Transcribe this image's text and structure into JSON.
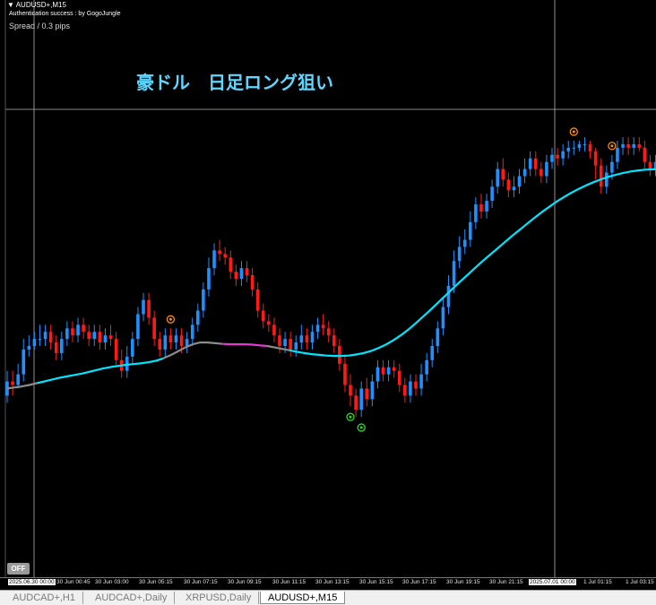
{
  "window": {
    "symbol_line": "▼ AUDUSD+,M15",
    "auth_line": "Authentication success : by GogoJungle",
    "spread_line": "Spread / 0.3 pips"
  },
  "headline": "豪ドル　日足ロング狙い",
  "off_button": "OFF",
  "colors": {
    "background": "#000000",
    "bull_candle": "#1e90ff",
    "bear_candle": "#ff1a1a",
    "ma_rising": "#00e5ff",
    "ma_falling": "#e23ad0",
    "ma_flat": "#8c8c8c",
    "signal_sell": "#ff8c00",
    "signal_buy": "#22dd22",
    "crosshair": "#b4b4b4",
    "headline": "#5fd7ff"
  },
  "time_axis": {
    "labels": [
      "2025.06.30 00:00",
      "30 Jun 00:45",
      "30 Jun 03:00",
      "30 Jun 05:15",
      "30 Jun 07:15",
      "30 Jun 09:15",
      "30 Jun 11:15",
      "30 Jun 13:15",
      "30 Jun 15:15",
      "30 Jun 17:15",
      "30 Jun 19:15",
      "30 Jun 21:15",
      "2025.07.01 00:00",
      "1 Jul 01:15",
      "1 Jul 03:15"
    ],
    "highlighted": [
      "2025.06.30 00:00",
      "2025.07.01 00:00"
    ]
  },
  "tabs": [
    {
      "label": "AUDCAD+,H1",
      "active": false
    },
    {
      "label": "AUDCAD+,Daily",
      "active": false
    },
    {
      "label": "XRPUSD,Daily",
      "active": false
    },
    {
      "label": "AUDUSD+,M15",
      "active": true
    }
  ],
  "chart_data": {
    "type": "candlestick",
    "symbol": "AUDUSD+",
    "timeframe": "M15",
    "description": "Relative price level 0-100 (price axis not visible). Each candle: [open, close, high, low].",
    "candles": [
      [
        27,
        31,
        34,
        25
      ],
      [
        31,
        30,
        34,
        27
      ],
      [
        30,
        33,
        36,
        29
      ],
      [
        33,
        40,
        43,
        31
      ],
      [
        40,
        41,
        44,
        38
      ],
      [
        41,
        43,
        45,
        40
      ],
      [
        43,
        43,
        47,
        41
      ],
      [
        43,
        45,
        47,
        41
      ],
      [
        45,
        42,
        47,
        40
      ],
      [
        42,
        39,
        44,
        37
      ],
      [
        39,
        43,
        45,
        37
      ],
      [
        43,
        46,
        48,
        41
      ],
      [
        46,
        44,
        48,
        42
      ],
      [
        44,
        47,
        49,
        42
      ],
      [
        47,
        45,
        49,
        43
      ],
      [
        45,
        43,
        47,
        41
      ],
      [
        43,
        45,
        47,
        41
      ],
      [
        45,
        42,
        47,
        40
      ],
      [
        42,
        44,
        46,
        40
      ],
      [
        44,
        43,
        47,
        41
      ],
      [
        43,
        37,
        45,
        35
      ],
      [
        37,
        34,
        40,
        32
      ],
      [
        34,
        38,
        41,
        32
      ],
      [
        38,
        43,
        45,
        36
      ],
      [
        43,
        50,
        52,
        41
      ],
      [
        50,
        54,
        56,
        48
      ],
      [
        54,
        49,
        56,
        47
      ],
      [
        49,
        43,
        51,
        41
      ],
      [
        43,
        40,
        45,
        38
      ],
      [
        40,
        44,
        46,
        38
      ],
      [
        44,
        42,
        46,
        40
      ],
      [
        42,
        44,
        46,
        40
      ],
      [
        44,
        41,
        46,
        39
      ],
      [
        41,
        43,
        45,
        39
      ],
      [
        43,
        47,
        49,
        41
      ],
      [
        47,
        51,
        53,
        45
      ],
      [
        51,
        57,
        59,
        49
      ],
      [
        57,
        63,
        66,
        55
      ],
      [
        63,
        68,
        70,
        61
      ],
      [
        68,
        67,
        71,
        65
      ],
      [
        67,
        66,
        69,
        64
      ],
      [
        66,
        62,
        68,
        60
      ],
      [
        62,
        60,
        64,
        58
      ],
      [
        60,
        63,
        65,
        58
      ],
      [
        63,
        61,
        65,
        59
      ],
      [
        61,
        57,
        63,
        55
      ],
      [
        57,
        51,
        59,
        49
      ],
      [
        51,
        48,
        53,
        46
      ],
      [
        48,
        47,
        50,
        45
      ],
      [
        47,
        44,
        49,
        42
      ],
      [
        44,
        41,
        46,
        39
      ],
      [
        41,
        43,
        45,
        39
      ],
      [
        43,
        40,
        45,
        38
      ],
      [
        40,
        42,
        44,
        38
      ],
      [
        42,
        44,
        47,
        40
      ],
      [
        44,
        42,
        46,
        40
      ],
      [
        42,
        45,
        47,
        40
      ],
      [
        45,
        47,
        49,
        43
      ],
      [
        47,
        46,
        50,
        44
      ],
      [
        46,
        44,
        48,
        42
      ],
      [
        44,
        41,
        46,
        39
      ],
      [
        41,
        36,
        43,
        34
      ],
      [
        36,
        30,
        38,
        28
      ],
      [
        30,
        27,
        33,
        24
      ],
      [
        27,
        23,
        29,
        21
      ],
      [
        23,
        29,
        31,
        21
      ],
      [
        29,
        26,
        32,
        24
      ],
      [
        26,
        31,
        33,
        24
      ],
      [
        31,
        35,
        37,
        29
      ],
      [
        35,
        33,
        37,
        31
      ],
      [
        33,
        35,
        37,
        31
      ],
      [
        35,
        34,
        37,
        32
      ],
      [
        34,
        30,
        36,
        28
      ],
      [
        30,
        27,
        32,
        25
      ],
      [
        27,
        31,
        33,
        25
      ],
      [
        31,
        29,
        33,
        27
      ],
      [
        29,
        33,
        36,
        27
      ],
      [
        33,
        37,
        39,
        31
      ],
      [
        37,
        41,
        43,
        35
      ],
      [
        41,
        46,
        48,
        39
      ],
      [
        46,
        52,
        55,
        44
      ],
      [
        52,
        58,
        61,
        50
      ],
      [
        58,
        65,
        68,
        56
      ],
      [
        65,
        69,
        72,
        63
      ],
      [
        69,
        71,
        74,
        67
      ],
      [
        71,
        76,
        79,
        69
      ],
      [
        76,
        81,
        83,
        74
      ],
      [
        81,
        79,
        84,
        77
      ],
      [
        79,
        82,
        84,
        77
      ],
      [
        82,
        86,
        88,
        80
      ],
      [
        86,
        91,
        93,
        84
      ],
      [
        91,
        88,
        94,
        86
      ],
      [
        88,
        85,
        90,
        83
      ],
      [
        85,
        86,
        89,
        83
      ],
      [
        86,
        89,
        91,
        84
      ],
      [
        89,
        91,
        94,
        87
      ],
      [
        91,
        94,
        96,
        89
      ],
      [
        94,
        91,
        96,
        89
      ],
      [
        91,
        89,
        93,
        87
      ],
      [
        89,
        93,
        95,
        87
      ],
      [
        93,
        95,
        97,
        91
      ],
      [
        95,
        94,
        97,
        92
      ],
      [
        94,
        96,
        98,
        92
      ],
      [
        96,
        97,
        99,
        94
      ],
      [
        97,
        97,
        99,
        95
      ],
      [
        97,
        98,
        99,
        96
      ],
      [
        98,
        98,
        100,
        96
      ],
      [
        98,
        96,
        99,
        94
      ],
      [
        96,
        92,
        97,
        88
      ],
      [
        92,
        86,
        94,
        84
      ],
      [
        86,
        90,
        92,
        84
      ],
      [
        90,
        93,
        95,
        88
      ],
      [
        93,
        97,
        99,
        91
      ],
      [
        97,
        98,
        100,
        95
      ],
      [
        98,
        97,
        100,
        95
      ],
      [
        97,
        98,
        100,
        95
      ],
      [
        98,
        97,
        100,
        96
      ],
      [
        97,
        93,
        99,
        91
      ],
      [
        93,
        91,
        95,
        89
      ],
      [
        91,
        93,
        95,
        89
      ],
      [
        93,
        92,
        95,
        90
      ],
      [
        92,
        90,
        94,
        88
      ],
      [
        90,
        86,
        92,
        84
      ],
      [
        86,
        82,
        88,
        80
      ],
      [
        82,
        76,
        84,
        74
      ]
    ],
    "moving_average": [
      29,
      29.3,
      29.6,
      30,
      30.5,
      31,
      31.5,
      32,
      32.4,
      32.8,
      33.2,
      33.7,
      34.2,
      34.7,
      35.1,
      35.4,
      35.7,
      35.9,
      36.1,
      36.4,
      36.8,
      37.5,
      38.4,
      39.5,
      40.6,
      41.5,
      42,
      42,
      41.8,
      41.6,
      41.5,
      41.5,
      41.5,
      41.4,
      41.2,
      41,
      40.6,
      40.2,
      39.8,
      39.4,
      39,
      38.7,
      38.5,
      38.3,
      38.2,
      38.2,
      38.3,
      38.6,
      39,
      39.6,
      40.4,
      41.4,
      42.6,
      44,
      45.6,
      47.4,
      49.3,
      51.2,
      53.2,
      55.2,
      57.2,
      59.2,
      61.1,
      63,
      64.9,
      66.7,
      68.5,
      70.3,
      72.1,
      73.8,
      75.5,
      77.2,
      78.8,
      80.3,
      81.8,
      83.1,
      84.3,
      85.4,
      86.4,
      87.3,
      88.1,
      88.8,
      89.4,
      89.9,
      90.3,
      90.6,
      90.8,
      90.9,
      90.9,
      90.8,
      90.6,
      90.4
    ],
    "ma_segments": [
      {
        "from": 0,
        "to": 5,
        "state": "flat"
      },
      {
        "from": 5,
        "to": 24,
        "state": "rising"
      },
      {
        "from": 24,
        "to": 29,
        "state": "rising"
      },
      {
        "from": 29,
        "to": 40,
        "state": "flat"
      },
      {
        "from": 40,
        "to": 48,
        "state": "falling"
      },
      {
        "from": 48,
        "to": 52,
        "state": "flat"
      },
      {
        "from": 52,
        "to": 125,
        "state": "rising"
      }
    ],
    "signals": [
      {
        "type": "sell",
        "candle": 30
      },
      {
        "type": "buy",
        "candle": 63
      },
      {
        "type": "buy",
        "candle": 65
      },
      {
        "type": "sell",
        "candle": 104
      },
      {
        "type": "sell",
        "candle": 111
      }
    ]
  }
}
